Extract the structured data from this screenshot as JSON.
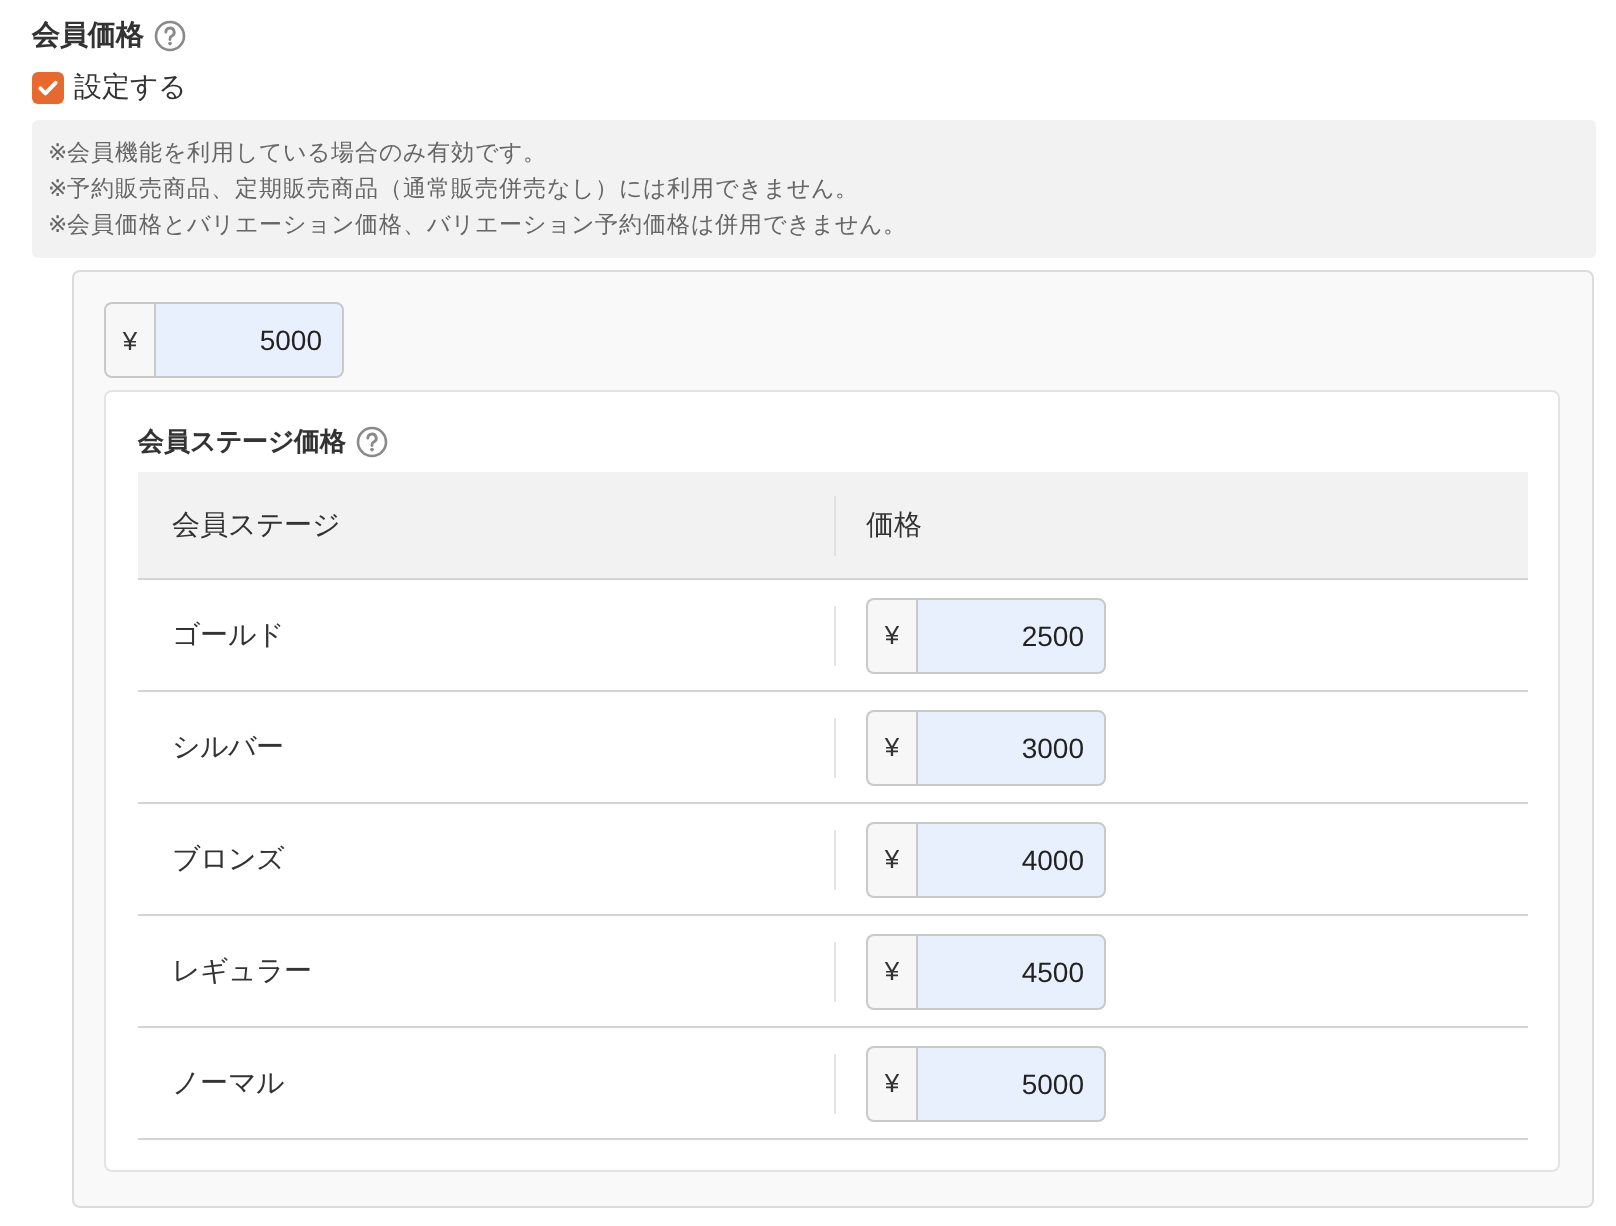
{
  "section": {
    "title": "会員価格"
  },
  "enable_checkbox": {
    "label": "設定する",
    "checked": true
  },
  "notes": [
    "※会員機能を利用している場合のみ有効です。",
    "※予約販売商品、定期販売商品（通常販売併売なし）には利用できません。",
    "※会員価格とバリエーション価格、バリエーション予約価格は併用できません。"
  ],
  "base_price": {
    "currency": "¥",
    "value": "5000"
  },
  "stage_prices": {
    "title": "会員ステージ価格",
    "columns": [
      "会員ステージ",
      "価格"
    ],
    "rows": [
      {
        "stage": "ゴールド",
        "currency": "¥",
        "price": "2500"
      },
      {
        "stage": "シルバー",
        "currency": "¥",
        "price": "3000"
      },
      {
        "stage": "ブロンズ",
        "currency": "¥",
        "price": "4000"
      },
      {
        "stage": "レギュラー",
        "currency": "¥",
        "price": "4500"
      },
      {
        "stage": "ノーマル",
        "currency": "¥",
        "price": "5000"
      }
    ]
  }
}
